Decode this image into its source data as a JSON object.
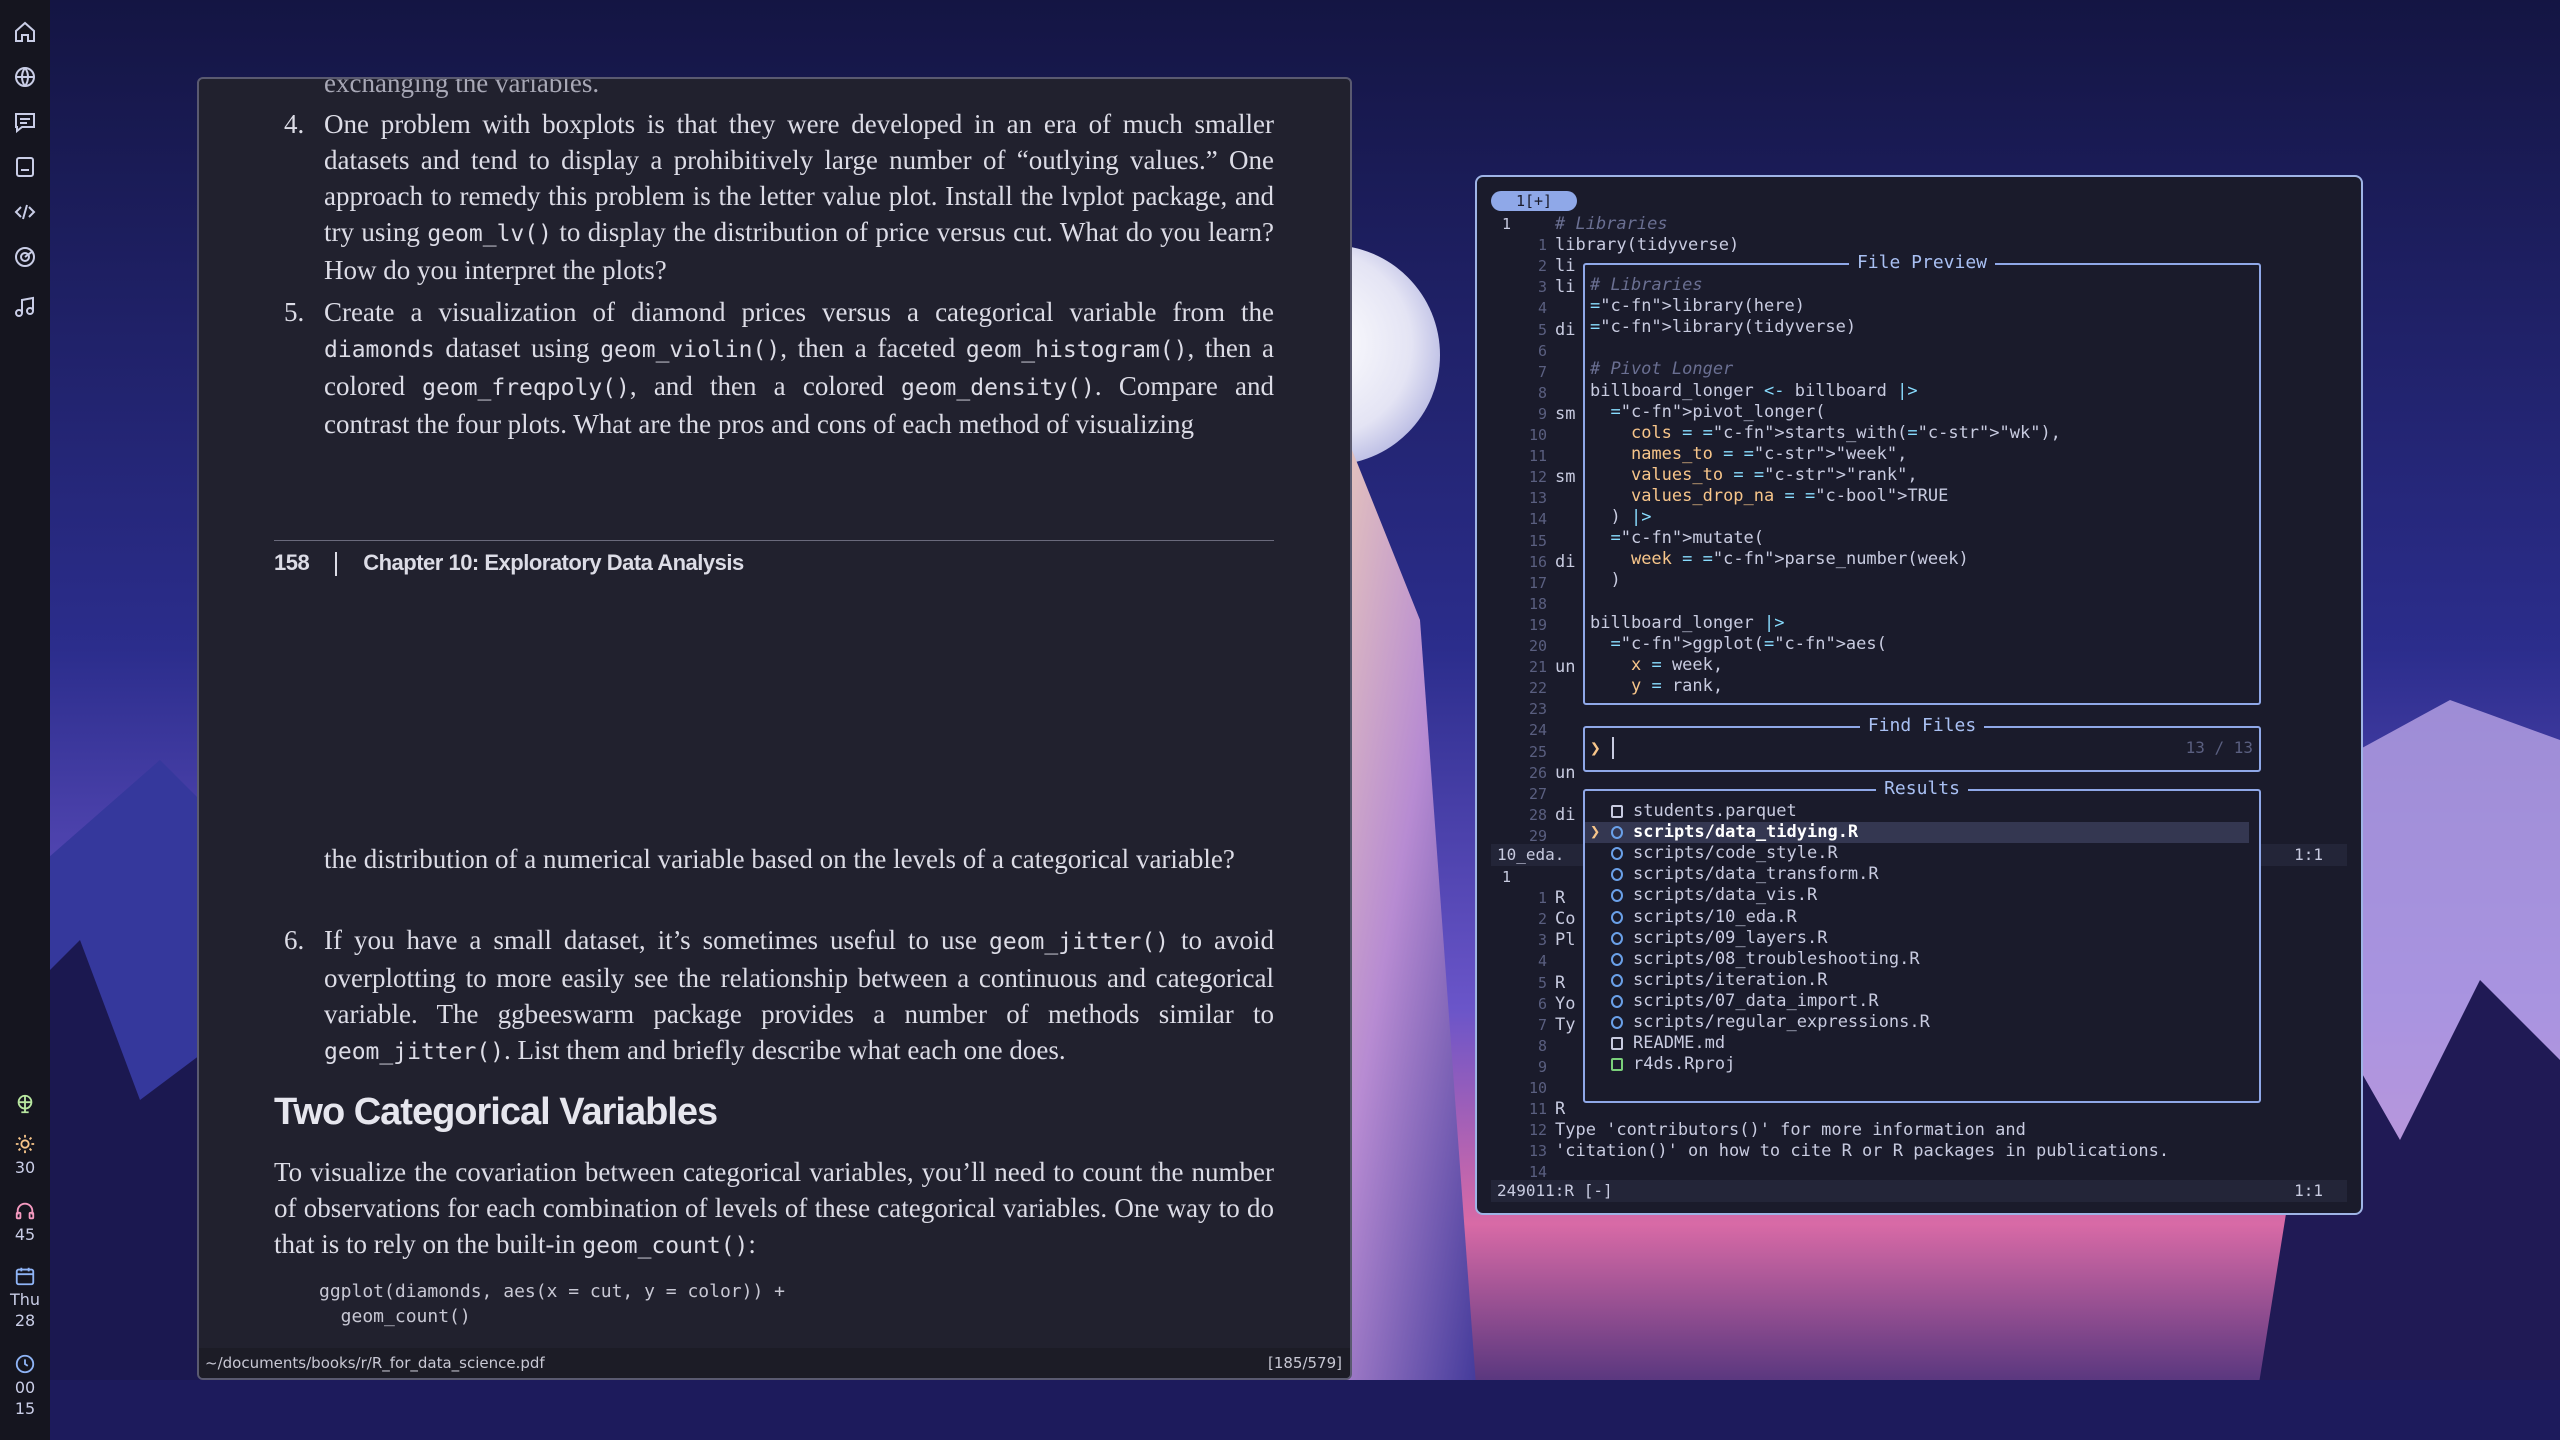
{
  "sidebar": {
    "icons": [
      "home-icon",
      "globe-icon",
      "chat-icon",
      "notes-icon",
      "code-icon",
      "radar-icon",
      "music-icon"
    ],
    "stats": {
      "brightness": "30",
      "volume": "45",
      "day": "Thu",
      "date": "28",
      "hour": "00",
      "minute": "15"
    }
  },
  "pdf": {
    "cut_line": "exchanging the variables.",
    "item4_num": "4.",
    "item4": {
      "t1": "One problem with boxplots is that they were developed in an era of much smaller datasets and tend to display a prohibitively large number of “outlying values.” One approach to remedy this problem is the letter value plot. Install the lvplot package, and try using ",
      "code": "geom_lv()",
      "t2": " to display the distribution of price versus cut. What do you learn? How do you interpret the plots?"
    },
    "item5_num": "5.",
    "item5": {
      "t1": "Create a visualization of diamond prices versus a categorical variable from the ",
      "c1": "diamonds",
      "t2": " dataset using ",
      "c2": "geom_violin()",
      "t3": ", then a faceted ",
      "c3": "geom_histogram()",
      "t4": ", then a colored ",
      "c4": "geom_freqpoly()",
      "t5": ", and then a colored ",
      "c5": "geom_density()",
      "t6": ". Compare and contrast the four plots. What are the pros and cons of each method of visualizing"
    },
    "page_number": "158",
    "chapter": "Chapter 10: Exploratory Data Analysis",
    "continued": "the distribution of a numerical variable based on the levels of a categorical variable?",
    "item6_num": "6.",
    "item6": {
      "t1": "If you have a small dataset, it’s sometimes useful to use ",
      "c1": "geom_jitter()",
      "t2": " to avoid overplotting to more easily see the relationship between a continuous and categorical variable. The ggbeeswarm package provides a number of methods similar to ",
      "c2": "geom_jitter()",
      "t3": ". List them and briefly describe what each one does."
    },
    "heading": "Two Categorical Variables",
    "para": {
      "t1": "To visualize the covariation between categorical variables, you’ll need to count the number of observations for each combination of levels of these categorical variables. One way to do that is to rely on the built-in ",
      "c1": "geom_count()",
      "t2": ":"
    },
    "code": [
      "ggplot(diamonds, aes(x = cut, y = color)) +",
      "  geom_count()"
    ],
    "path": "~/documents/books/r/R_for_data_science.pdf",
    "page_indicator": "[185/579]"
  },
  "editor": {
    "tab_label": "1[+]",
    "top_lines": [
      {
        "n": "1",
        "t": "# Libraries"
      },
      {
        "n": "1",
        "t": "library(tidyverse)"
      },
      {
        "n": "2",
        "t": "li"
      },
      {
        "n": "3",
        "t": "li"
      },
      {
        "n": "4",
        "t": ""
      },
      {
        "n": "5",
        "t": "di"
      },
      {
        "n": "6",
        "t": ""
      },
      {
        "n": "7",
        "t": ""
      },
      {
        "n": "8",
        "t": ""
      },
      {
        "n": "9",
        "t": "sm"
      },
      {
        "n": "10",
        "t": ""
      },
      {
        "n": "11",
        "t": ""
      },
      {
        "n": "12",
        "t": "sm"
      },
      {
        "n": "13",
        "t": ""
      },
      {
        "n": "14",
        "t": ""
      },
      {
        "n": "15",
        "t": ""
      },
      {
        "n": "16",
        "t": "di"
      },
      {
        "n": "17",
        "t": ""
      },
      {
        "n": "18",
        "t": ""
      },
      {
        "n": "19",
        "t": ""
      },
      {
        "n": "20",
        "t": ""
      },
      {
        "n": "21",
        "t": "un"
      },
      {
        "n": "22",
        "t": ""
      },
      {
        "n": "23",
        "t": ""
      },
      {
        "n": "24",
        "t": ""
      },
      {
        "n": "25",
        "t": ""
      },
      {
        "n": "26",
        "t": "un"
      },
      {
        "n": "27",
        "t": ""
      },
      {
        "n": "28",
        "t": "di"
      },
      {
        "n": "29",
        "t": ""
      }
    ],
    "status1_left": "10_eda.",
    "status1_right": "1:1",
    "bottom_lines": [
      {
        "n": "1",
        "t": ""
      },
      {
        "n": "1",
        "t": "R"
      },
      {
        "n": "2",
        "t": "Co"
      },
      {
        "n": "3",
        "t": "Pl"
      },
      {
        "n": "4",
        "t": ""
      },
      {
        "n": "5",
        "t": "R"
      },
      {
        "n": "6",
        "t": "Yo"
      },
      {
        "n": "7",
        "t": "Ty"
      },
      {
        "n": "8",
        "t": ""
      },
      {
        "n": "9",
        "t": ""
      },
      {
        "n": "10",
        "t": ""
      },
      {
        "n": "11",
        "t": "R"
      },
      {
        "n": "12",
        "t": "Type 'contributors()' for more information and"
      },
      {
        "n": "13",
        "t": "'citation()' on how to cite R or R packages in publications."
      },
      {
        "n": "14",
        "t": ""
      }
    ],
    "status2_left": "249011:R  [-]",
    "status2_right": "1:1"
  },
  "file_preview": {
    "title": "File Preview",
    "lines": [
      "# Libraries",
      "library(here)",
      "library(tidyverse)",
      "",
      "# Pivot Longer",
      "billboard_longer <- billboard |>",
      "  pivot_longer(",
      "    cols = starts_with(\"wk\"),",
      "    names_to = \"week\",",
      "    values_to = \"rank\",",
      "    values_drop_na = TRUE",
      "  ) |>",
      "  mutate(",
      "    week = parse_number(week)",
      "  )",
      "",
      "billboard_longer |>",
      "  ggplot(aes(",
      "    x = week,",
      "    y = rank,"
    ]
  },
  "find_files": {
    "title": "Find Files",
    "prompt": "❯",
    "query": "",
    "count": "13 / 13"
  },
  "results": {
    "title": "Results",
    "items": [
      {
        "name": "students.parquet",
        "icon": "file-icon"
      },
      {
        "name": "scripts/data_tidying.R",
        "icon": "r-file-icon"
      },
      {
        "name": "scripts/code_style.R",
        "icon": "r-file-icon"
      },
      {
        "name": "scripts/data_transform.R",
        "icon": "r-file-icon"
      },
      {
        "name": "scripts/data_vis.R",
        "icon": "r-file-icon"
      },
      {
        "name": "scripts/10_eda.R",
        "icon": "r-file-icon"
      },
      {
        "name": "scripts/09_layers.R",
        "icon": "r-file-icon"
      },
      {
        "name": "scripts/08_troubleshooting.R",
        "icon": "r-file-icon"
      },
      {
        "name": "scripts/iteration.R",
        "icon": "r-file-icon"
      },
      {
        "name": "scripts/07_data_import.R",
        "icon": "r-file-icon"
      },
      {
        "name": "scripts/regular_expressions.R",
        "icon": "r-file-icon"
      },
      {
        "name": "README.md",
        "icon": "markdown-icon"
      },
      {
        "name": "r4ds.Rproj",
        "icon": "rproj-icon"
      }
    ],
    "selected_index": 1
  },
  "colors": {
    "accent": "#8fa8e8",
    "pdf_bg": "#21212e",
    "term_bg": "#1a1b2b"
  }
}
